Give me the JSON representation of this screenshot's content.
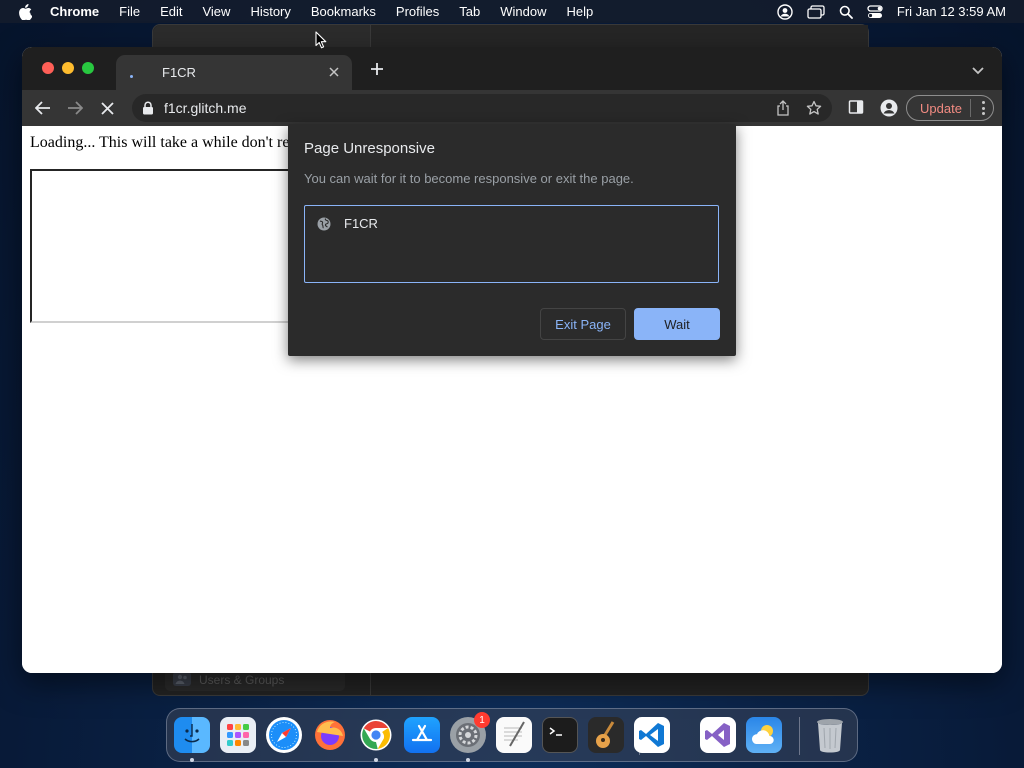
{
  "menubar": {
    "app_name": "Chrome",
    "items": [
      "File",
      "Edit",
      "View",
      "History",
      "Bookmarks",
      "Profiles",
      "Tab",
      "Window",
      "Help"
    ],
    "clock": "Fri Jan 12  3:59 AM"
  },
  "background_window": {
    "sidebar_item": "Users & Groups"
  },
  "browser": {
    "tab_title": "F1CR",
    "url": "f1cr.glitch.me",
    "update_label": "Update"
  },
  "page": {
    "loading_text": "Loading... This will take a while don't re"
  },
  "dialog": {
    "title": "Page Unresponsive",
    "subtitle": "You can wait for it to become responsive or exit the page.",
    "list_item": "F1CR",
    "exit_label": "Exit Page",
    "wait_label": "Wait"
  },
  "dock": {
    "apps": [
      "Finder",
      "Launchpad",
      "Safari",
      "Firefox",
      "Google Chrome",
      "App Store",
      "System Settings",
      "TextEdit",
      "Terminal",
      "GarageBand",
      "Visual Studio Code",
      "Visual Studio",
      "Weather",
      "Trash"
    ],
    "settings_badge": "1"
  },
  "colors": {
    "accent": "#8ab4f8",
    "update_text": "#f28b82",
    "tab_strip": "#1f1f1f",
    "toolbar": "#353535",
    "dialog_bg": "#2b2b2b"
  }
}
